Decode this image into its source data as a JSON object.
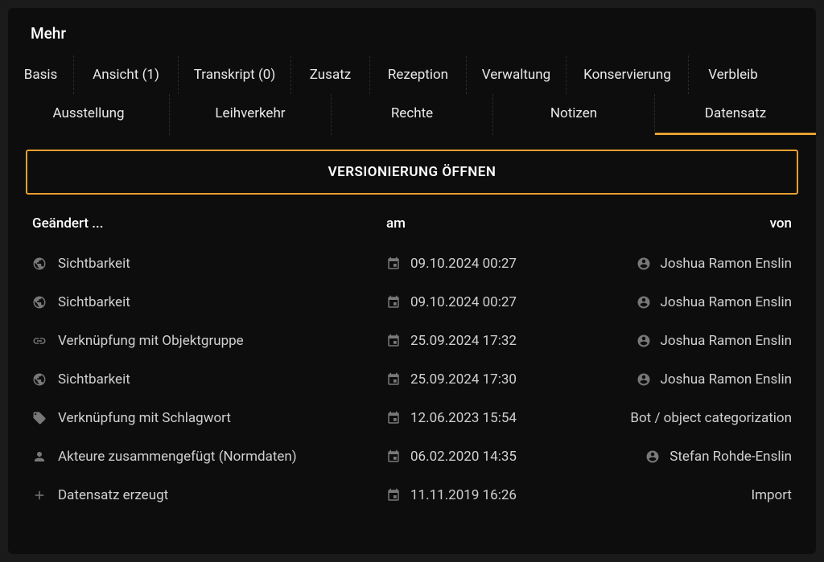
{
  "header": {
    "title": "Mehr"
  },
  "tabs": {
    "row1": [
      {
        "label": "Basis"
      },
      {
        "label": "Ansicht (1)"
      },
      {
        "label": "Transkript (0)"
      },
      {
        "label": "Zusatz"
      },
      {
        "label": "Rezeption"
      },
      {
        "label": "Verwaltung"
      },
      {
        "label": "Konservierung"
      },
      {
        "label": "Verbleib"
      }
    ],
    "row2": [
      {
        "label": "Ausstellung"
      },
      {
        "label": "Leihverkehr"
      },
      {
        "label": "Rechte"
      },
      {
        "label": "Notizen"
      },
      {
        "label": "Datensatz",
        "active": true
      }
    ]
  },
  "content": {
    "open_button": "VERSIONIERUNG ÖFFNEN",
    "table_headers": {
      "changed": "Geändert ...",
      "date": "am",
      "by": "von"
    },
    "rows": [
      {
        "icon": "globe",
        "changed": "Sichtbarkeit",
        "date": "09.10.2024 00:27",
        "by": "Joshua Ramon Enslin",
        "by_icon": "user"
      },
      {
        "icon": "globe",
        "changed": "Sichtbarkeit",
        "date": "09.10.2024 00:27",
        "by": "Joshua Ramon Enslin",
        "by_icon": "user"
      },
      {
        "icon": "link",
        "changed": "Verknüpfung mit Objektgruppe",
        "date": "25.09.2024 17:32",
        "by": "Joshua Ramon Enslin",
        "by_icon": "user"
      },
      {
        "icon": "globe",
        "changed": "Sichtbarkeit",
        "date": "25.09.2024 17:30",
        "by": "Joshua Ramon Enslin",
        "by_icon": "user"
      },
      {
        "icon": "tag",
        "changed": "Verknüpfung mit Schlagwort",
        "date": "12.06.2023 15:54",
        "by": "Bot / object categorization",
        "by_icon": "none"
      },
      {
        "icon": "person",
        "changed": "Akteure zusammengefügt (Normdaten)",
        "date": "06.02.2020 14:35",
        "by": "Stefan Rohde-Enslin",
        "by_icon": "user"
      },
      {
        "icon": "plus",
        "changed": "Datensatz erzeugt",
        "date": "11.11.2019 16:26",
        "by": "Import",
        "by_icon": "none"
      }
    ]
  }
}
